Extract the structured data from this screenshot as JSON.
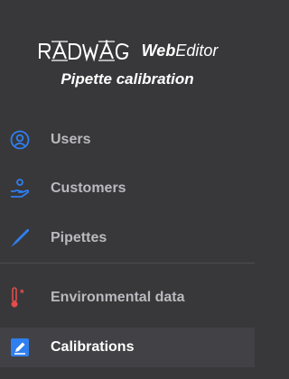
{
  "brand": {
    "logo_text": "RADWAG",
    "product_bold": "Web",
    "product_regular": "Editor",
    "subtitle": "Pipette calibration"
  },
  "nav": {
    "items": [
      {
        "label": "Users",
        "icon": "user-circle-icon",
        "active": false
      },
      {
        "label": "Customers",
        "icon": "customer-hand-icon",
        "active": false
      },
      {
        "label": "Pipettes",
        "icon": "pipette-icon",
        "active": false
      },
      {
        "label": "Environmental data",
        "icon": "thermometer-icon",
        "active": false
      },
      {
        "label": "Calibrations",
        "icon": "calibration-edit-icon",
        "active": true
      }
    ]
  },
  "colors": {
    "background": "#38383a",
    "active_background": "#424246",
    "icon_accent": "#2f7ff0",
    "thermometer_red": "#e24d4d",
    "label": "#b9b9bf",
    "active_label": "#ffffff"
  }
}
